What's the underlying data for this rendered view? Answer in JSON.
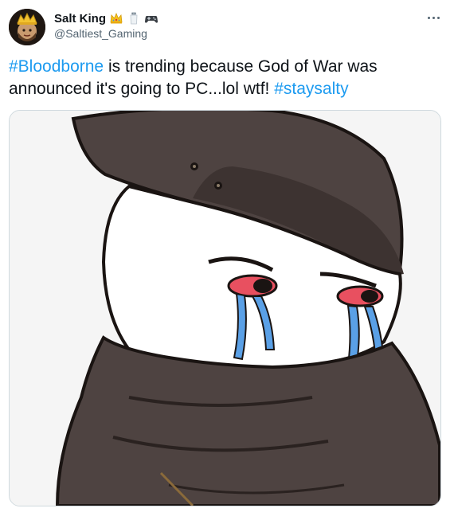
{
  "author": {
    "display_name": "Salt King",
    "handle": "@Saltiest_Gaming",
    "name_emojis": [
      "crown-emoji",
      "salt-shaker-emoji",
      "game-controller-emoji"
    ]
  },
  "tweet": {
    "segments": [
      {
        "text": "#Bloodborne",
        "type": "hashtag"
      },
      {
        "text": " is trending because God of War was announced it's going to PC...lol wtf! ",
        "type": "text"
      },
      {
        "text": "#staysalty",
        "type": "hashtag"
      }
    ]
  },
  "media": {
    "kind": "meme-illustration",
    "subject": "crying-hunter"
  },
  "colors": {
    "link": "#1d9bf0",
    "text": "#0f1419",
    "secondary": "#536471",
    "border": "#cfd9de"
  }
}
